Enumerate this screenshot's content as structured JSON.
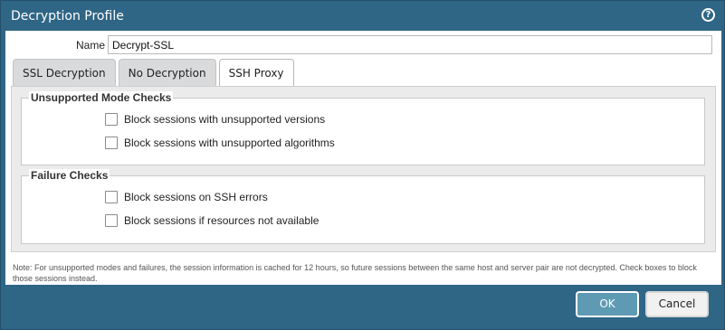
{
  "dialog": {
    "title": "Decryption Profile",
    "help_icon": "question-circle-icon"
  },
  "name_field": {
    "label": "Name",
    "value": "Decrypt-SSL"
  },
  "tabs": [
    {
      "label": "SSL Decryption",
      "active": false
    },
    {
      "label": "No Decryption",
      "active": false
    },
    {
      "label": "SSH Proxy",
      "active": true
    }
  ],
  "groups": [
    {
      "legend": "Unsupported Mode Checks",
      "options": [
        {
          "label": "Block sessions with unsupported versions",
          "checked": false
        },
        {
          "label": "Block sessions with unsupported algorithms",
          "checked": false
        }
      ]
    },
    {
      "legend": "Failure Checks",
      "options": [
        {
          "label": "Block sessions on SSH errors",
          "checked": false
        },
        {
          "label": "Block sessions if resources not available",
          "checked": false
        }
      ]
    }
  ],
  "note": "Note: For unsupported modes and failures, the session information is cached for 12 hours, so future sessions between the same host and server pair are not decrypted. Check boxes to block those sessions instead.",
  "buttons": {
    "ok": "OK",
    "cancel": "Cancel"
  },
  "colors": {
    "frame": "#2f6585",
    "ok_button": "#5f9ab4"
  }
}
